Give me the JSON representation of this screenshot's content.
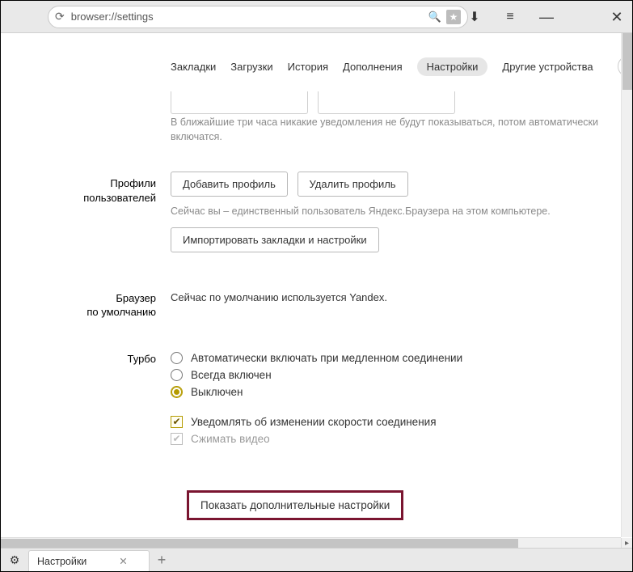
{
  "titlebar": {
    "url": "browser://settings"
  },
  "nav": {
    "bookmarks": "Закладки",
    "downloads": "Загрузки",
    "history": "История",
    "addons": "Дополнения",
    "settings": "Настройки",
    "other_devices": "Другие устройства"
  },
  "notif": {
    "hint": "В ближайшие три часа никакие уведомления не будут показываться, потом автоматически включатся."
  },
  "profiles": {
    "label_l1": "Профили",
    "label_l2": "пользователей",
    "add": "Добавить профиль",
    "remove": "Удалить профиль",
    "hint": "Сейчас вы – единственный пользователь Яндекс.Браузера на этом компьютере.",
    "import": "Импортировать закладки и настройки"
  },
  "default_browser": {
    "label_l1": "Браузер",
    "label_l2": "по умолчанию",
    "text": "Сейчас по умолчанию используется Yandex."
  },
  "turbo": {
    "label": "Турбо",
    "opt_auto": "Автоматически включать при медленном соединении",
    "opt_on": "Всегда включен",
    "opt_off": "Выключен",
    "chk_notify": "Уведомлять об изменении скорости соединения",
    "chk_video": "Сжимать видео"
  },
  "show_more": "Показать дополнительные настройки",
  "tab": {
    "title": "Настройки"
  }
}
